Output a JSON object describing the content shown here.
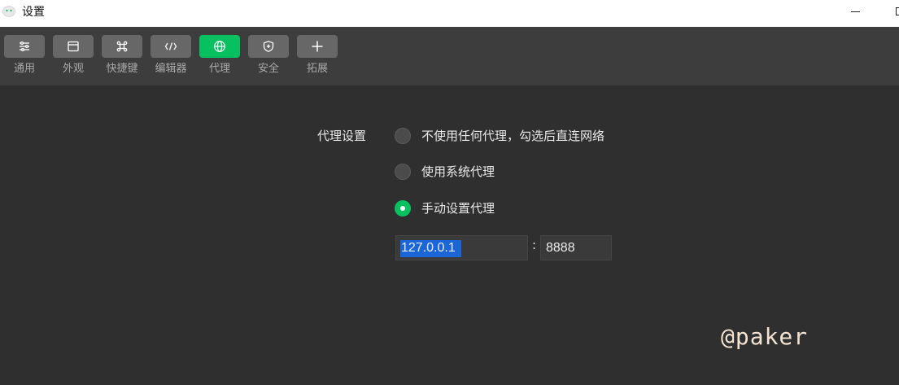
{
  "window": {
    "title": "设置",
    "icon": "wechat-devtools-icon"
  },
  "toolbar": {
    "items": [
      {
        "label": "通用",
        "icon": "sliders-icon"
      },
      {
        "label": "外观",
        "icon": "window-icon"
      },
      {
        "label": "快捷键",
        "icon": "command-icon"
      },
      {
        "label": "编辑器",
        "icon": "code-icon"
      },
      {
        "label": "代理",
        "icon": "globe-icon",
        "active": true
      },
      {
        "label": "安全",
        "icon": "shield-icon"
      },
      {
        "label": "拓展",
        "icon": "plus-icon"
      }
    ],
    "active_color": "#07c160"
  },
  "proxy": {
    "section_label": "代理设置",
    "options": [
      {
        "label": "不使用任何代理，勾选后直连网络",
        "checked": false
      },
      {
        "label": "使用系统代理",
        "checked": false
      },
      {
        "label": "手动设置代理",
        "checked": true
      }
    ],
    "host": "127.0.0.1",
    "separator": ":",
    "port": "8888"
  },
  "watermark": "@paker"
}
